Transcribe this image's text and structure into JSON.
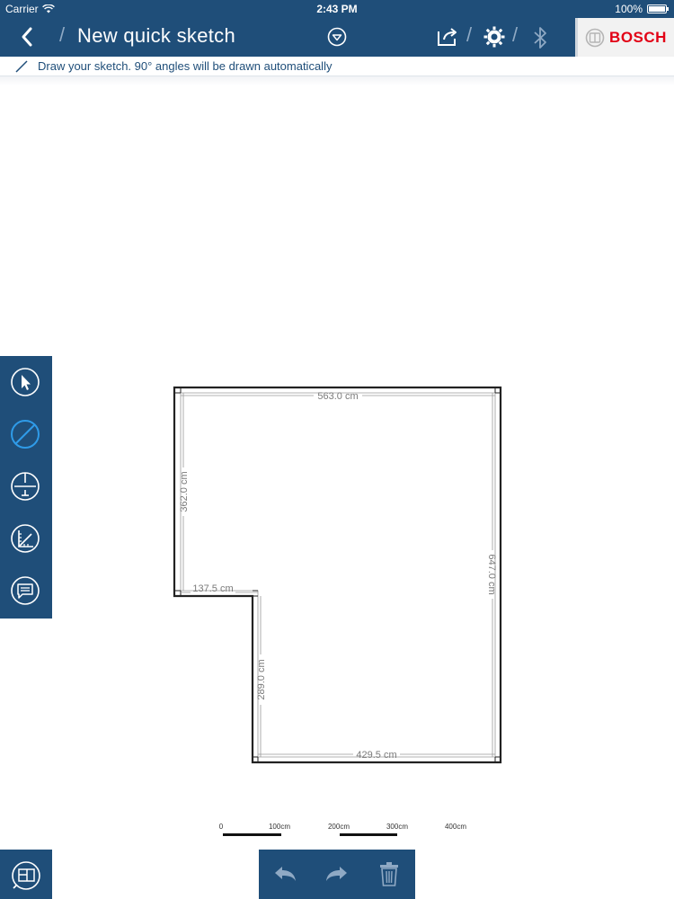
{
  "status_bar": {
    "carrier": "Carrier",
    "time": "2:43 PM",
    "battery": "100%",
    "battery_level": 1.0
  },
  "nav": {
    "title": "New quick sketch",
    "back_icon": "chevron-left-icon",
    "dropdown_icon": "chevron-down-circle-icon",
    "share_icon": "share-icon",
    "settings_icon": "gear-icon",
    "bluetooth_icon": "bluetooth-icon",
    "brand": "BOSCH",
    "brand_color": "#e20015"
  },
  "hint": {
    "text": "Draw your sketch. 90° angles will be drawn automatically",
    "icon": "pencil-line-icon"
  },
  "tools": [
    {
      "name": "select",
      "icon": "pointer-icon"
    },
    {
      "name": "draw-line",
      "icon": "line-draw-icon",
      "active": true
    },
    {
      "name": "measure-point",
      "icon": "measure-point-icon"
    },
    {
      "name": "measure-angle",
      "icon": "angle-ruler-icon"
    },
    {
      "name": "comment",
      "icon": "comment-icon"
    }
  ],
  "sketch": {
    "dimensions": {
      "top": "563.0 cm",
      "left_upper": "362.0 cm",
      "step": "137.5 cm",
      "left_lower": "289.0 cm",
      "bottom": "429.5 cm",
      "right": "647.0 cm"
    }
  },
  "scale_bar": {
    "labels": [
      "0",
      "100cm",
      "200cm",
      "300cm",
      "400cm"
    ]
  },
  "bottom_toolbar": {
    "plan_icon": "floor-plan-icon",
    "undo_icon": "undo-icon",
    "redo_icon": "redo-icon",
    "delete_icon": "trash-icon"
  },
  "colors": {
    "primary": "#1f4e79",
    "wall": "#222222",
    "dimension_text": "#7a7a7a"
  }
}
